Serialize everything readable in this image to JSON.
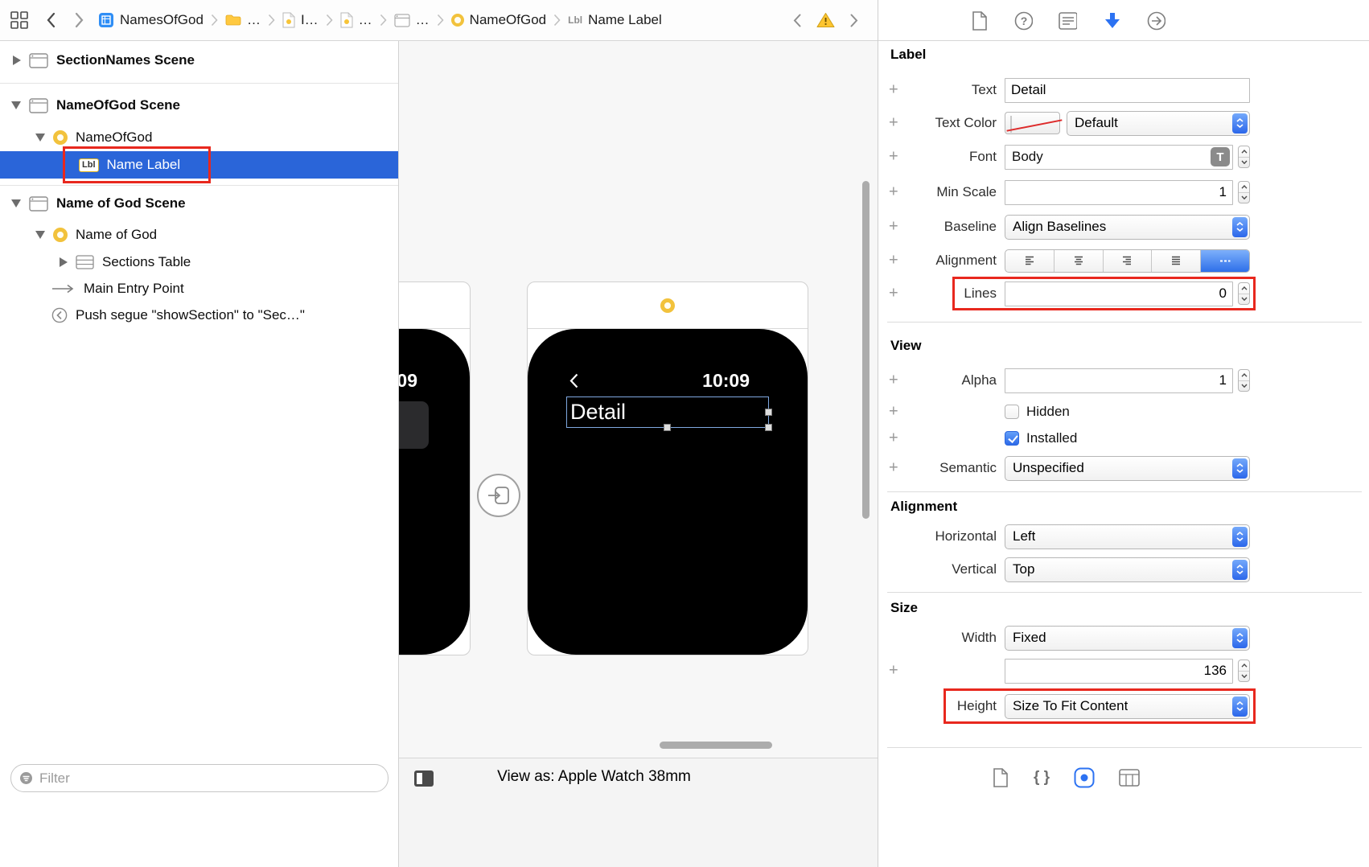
{
  "window": {
    "breadcrumb": {
      "items": [
        {
          "label": "NamesOfGod"
        },
        {
          "label": "…"
        },
        {
          "label": "I…"
        },
        {
          "label": "…"
        },
        {
          "label": "…"
        },
        {
          "label": "NameOfGod"
        },
        {
          "label": "Name Label",
          "badge": "Lbl"
        }
      ]
    }
  },
  "outline": {
    "rows": [
      {
        "label": "SectionNames Scene"
      },
      {
        "label": "NameOfGod Scene"
      },
      {
        "label": "NameOfGod"
      },
      {
        "label": "Name Label",
        "badge": "Lbl"
      },
      {
        "label": "Name of God Scene"
      },
      {
        "label": "Name of God"
      },
      {
        "label": "Sections Table"
      },
      {
        "label": "Main Entry Point"
      },
      {
        "label": "Push segue \"showSection\" to \"Sec…\""
      }
    ],
    "filter_placeholder": "Filter"
  },
  "canvas": {
    "left_watch": {
      "time_fragment": "09"
    },
    "right_watch": {
      "time": "10:09",
      "label_text": "Detail"
    },
    "view_as": "View as: Apple Watch 38mm"
  },
  "inspector": {
    "plus_glyph": "+",
    "font_button_glyph": "T",
    "snippet_glyph": "{ }",
    "label": {
      "title": "Label",
      "text": {
        "label": "Text",
        "value": "Detail"
      },
      "text_color": {
        "label": "Text Color",
        "value": "Default"
      },
      "font": {
        "label": "Font",
        "value": "Body"
      },
      "min_scale": {
        "label": "Min Scale",
        "value": "1"
      },
      "baseline": {
        "label": "Baseline",
        "value": "Align Baselines"
      },
      "alignment": {
        "label": "Alignment"
      },
      "lines": {
        "label": "Lines",
        "value": "0"
      }
    },
    "view": {
      "title": "View",
      "alpha": {
        "label": "Alpha",
        "value": "1"
      },
      "hidden": {
        "label": "Hidden",
        "checked": false
      },
      "installed": {
        "label": "Installed",
        "checked": true
      },
      "semantic": {
        "label": "Semantic",
        "value": "Unspecified"
      }
    },
    "alignment": {
      "title": "Alignment",
      "horizontal": {
        "label": "Horizontal",
        "value": "Left"
      },
      "vertical": {
        "label": "Vertical",
        "value": "Top"
      }
    },
    "size": {
      "title": "Size",
      "width": {
        "label": "Width",
        "value": "Fixed",
        "number": "136"
      },
      "height": {
        "label": "Height",
        "value": "Size To Fit Content"
      }
    }
  }
}
